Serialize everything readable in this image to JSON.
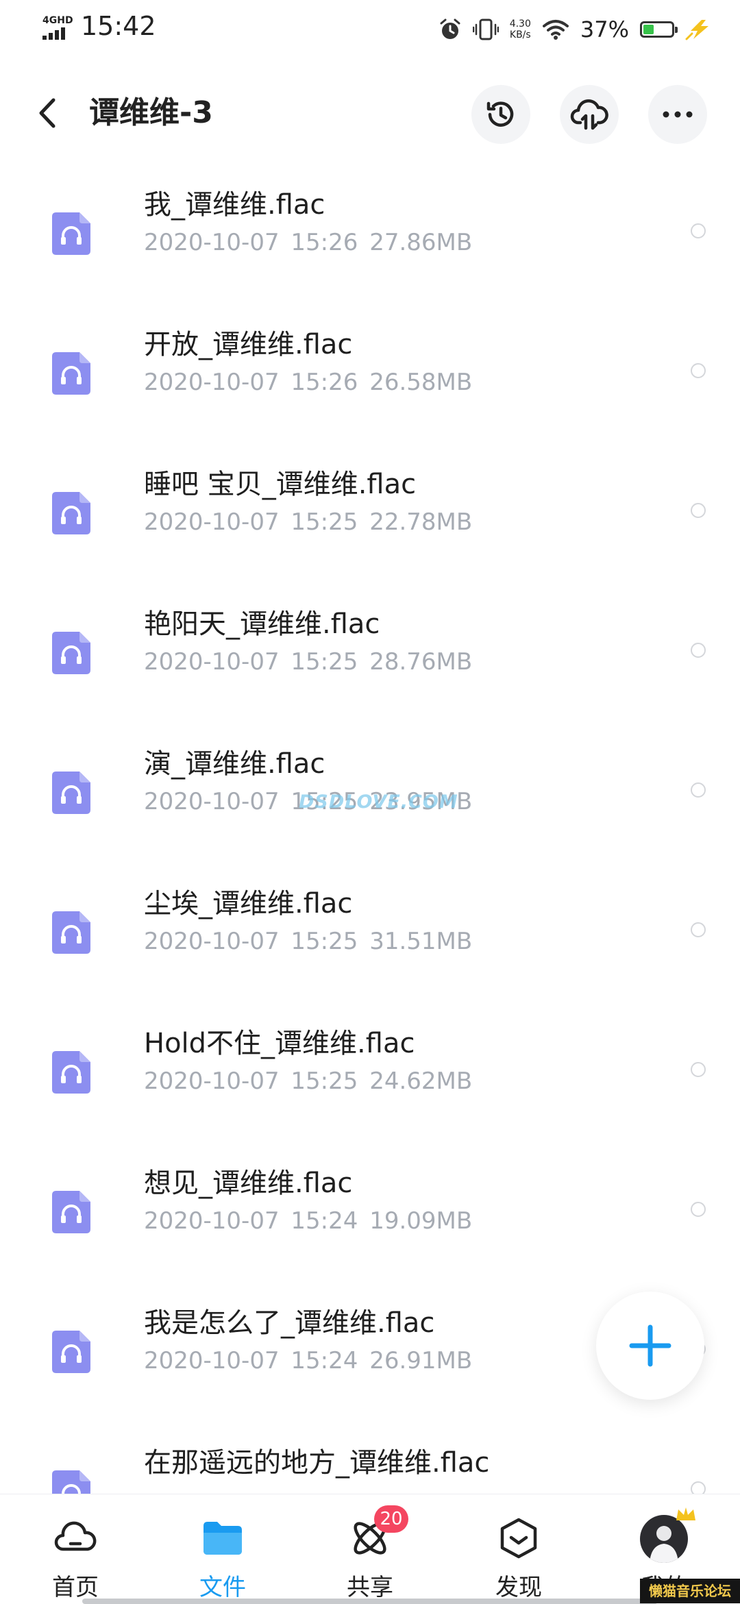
{
  "status_bar": {
    "network": "4GHD",
    "time": "15:42",
    "speed_value": "4.30",
    "speed_unit": "KB/s",
    "battery_percent": "37%",
    "battery_level": 0.37,
    "icons": [
      "alarm-icon",
      "vibrate-icon",
      "wifi-icon",
      "battery-icon",
      "charging-icon"
    ]
  },
  "header": {
    "title": "谭维维-3",
    "actions": [
      "history-icon",
      "cloud-transfer-icon",
      "more-icon"
    ]
  },
  "files": [
    {
      "name": "我_谭维维.flac",
      "date": "2020-10-07",
      "time": "15:26",
      "size": "27.86MB"
    },
    {
      "name": "开放_谭维维.flac",
      "date": "2020-10-07",
      "time": "15:26",
      "size": "26.58MB"
    },
    {
      "name": "睡吧 宝贝_谭维维.flac",
      "date": "2020-10-07",
      "time": "15:25",
      "size": "22.78MB"
    },
    {
      "name": "艳阳天_谭维维.flac",
      "date": "2020-10-07",
      "time": "15:25",
      "size": "28.76MB"
    },
    {
      "name": "演_谭维维.flac",
      "date": "2020-10-07",
      "time": "15:25",
      "size": "23.95MB"
    },
    {
      "name": "尘埃_谭维维.flac",
      "date": "2020-10-07",
      "time": "15:25",
      "size": "31.51MB"
    },
    {
      "name": "Hold不住_谭维维.flac",
      "date": "2020-10-07",
      "time": "15:25",
      "size": "24.62MB"
    },
    {
      "name": "想见_谭维维.flac",
      "date": "2020-10-07",
      "time": "15:24",
      "size": "19.09MB"
    },
    {
      "name": "我是怎么了_谭维维.flac",
      "date": "2020-10-07",
      "time": "15:24",
      "size": "26.91MB"
    },
    {
      "name": "在那遥远的地方_谭维维.flac",
      "date": "",
      "time": "",
      "size": ""
    }
  ],
  "watermark": "DSDLOVE.COM",
  "fab": {
    "icon": "plus-icon"
  },
  "bottom_nav": {
    "items": [
      {
        "label": "首页",
        "icon": "home-cloud-icon"
      },
      {
        "label": "文件",
        "icon": "folder-icon",
        "active": true
      },
      {
        "label": "共享",
        "icon": "share-atom-icon",
        "badge": "20"
      },
      {
        "label": "发现",
        "icon": "discover-icon"
      },
      {
        "label": "我的",
        "icon": "avatar"
      }
    ]
  },
  "forum_stamp": "懒猫音乐论坛",
  "colors": {
    "accent": "#1a9bf0",
    "file_icon": "#8c8ef0",
    "meta_text": "#a6abb3",
    "badge": "#f44660"
  }
}
